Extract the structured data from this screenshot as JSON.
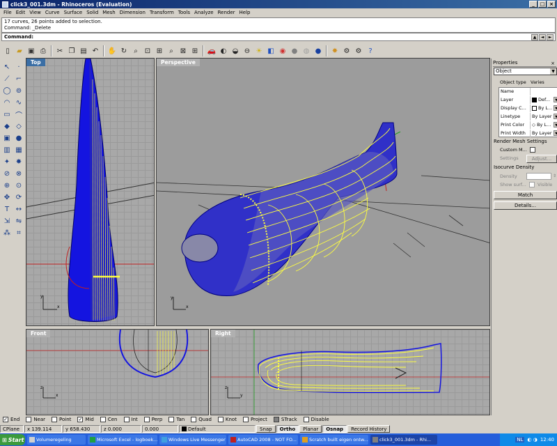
{
  "window": {
    "title": "click3_001.3dm - Rhinoceros (Evaluation)",
    "buttons": [
      "_",
      "□",
      "×"
    ]
  },
  "menu": [
    "File",
    "Edit",
    "View",
    "Curve",
    "Surface",
    "Solid",
    "Mesh",
    "Dimension",
    "Transform",
    "Tools",
    "Analyze",
    "Render",
    "Help"
  ],
  "command": {
    "history": [
      "17 curves, 26 points added to selection.",
      "Command: _Delete"
    ],
    "prompt": "Command:"
  },
  "toolbar_icons": [
    "new-file-icon",
    "open-folder-icon",
    "save-icon",
    "print-icon",
    "cut-icon",
    "copy-icon",
    "paste-icon",
    "undo-icon",
    "pan-hand-icon",
    "rotate-view-icon",
    "zoom-icon",
    "zoom-window-icon",
    "zoom-extents-icon",
    "zoom-selected-icon",
    "zoom-all-icon",
    "four-viewports-icon",
    "car-icon",
    "hide-icon",
    "show-icon",
    "lock-icon",
    "light-bulb-icon",
    "layer-icon",
    "color-wheel-icon",
    "render-sphere-icon",
    "shade-icon",
    "render-icon",
    "material-icon",
    "options-gear-icon",
    "help-icon"
  ],
  "viewports": {
    "top": "Top",
    "perspective": "Perspective",
    "front": "Front",
    "right": "Right"
  },
  "properties": {
    "title": "Properties",
    "close": "×",
    "selector": "Object",
    "object_type_label": "Object type",
    "object_type_value": "Varies",
    "rows": [
      {
        "label": "Name",
        "value": ""
      },
      {
        "label": "Layer",
        "value": "Def..."
      },
      {
        "label": "Display C...",
        "value": "By L..."
      },
      {
        "label": "Linetype",
        "value": "By Layer"
      },
      {
        "label": "Print Color",
        "value": "By L..."
      },
      {
        "label": "Print Width",
        "value": "By Layer"
      }
    ],
    "render_mesh_title": "Render Mesh Settings",
    "custom_mesh_label": "Custom M...",
    "settings_label": "Settings",
    "adjust_label": "Adjust...",
    "isocurve_title": "Isocurve Density",
    "density_label": "Density",
    "show_surface_label": "Show surf...",
    "visible_label": "Visible",
    "match_button": "Match",
    "details_button": "Details..."
  },
  "osnaps": [
    {
      "label": "End",
      "checked": true
    },
    {
      "label": "Near",
      "checked": false
    },
    {
      "label": "Point",
      "checked": false
    },
    {
      "label": "Mid",
      "checked": true
    },
    {
      "label": "Cen",
      "checked": false
    },
    {
      "label": "Int",
      "checked": false
    },
    {
      "label": "Perp",
      "checked": false
    },
    {
      "label": "Tan",
      "checked": false
    },
    {
      "label": "Quad",
      "checked": false
    },
    {
      "label": "Knot",
      "checked": false
    },
    {
      "label": "Project",
      "checked": false
    },
    {
      "label": "STrack",
      "checked": false
    },
    {
      "label": "Disable",
      "checked": false
    }
  ],
  "status": {
    "cplane": "CPlane",
    "x": "x 139.114",
    "y": "y 658.430",
    "z": "z 0.000",
    "extra": "0.000",
    "layer": "Default",
    "snap": "Snap",
    "ortho": "Ortho",
    "planar": "Planar",
    "osnap": "Osnap",
    "record": "Record History"
  },
  "taskbar": {
    "start": "Start",
    "tasks": [
      {
        "label": "Volumeregeling",
        "active": false
      },
      {
        "label": "Microsoft Excel - logboek...",
        "active": false
      },
      {
        "label": "Windows Live Messenger",
        "active": false
      },
      {
        "label": "AutoCAD 2008 - NOT FO...",
        "active": false
      },
      {
        "label": "Scratch built eigen ontw...",
        "active": false
      },
      {
        "label": "click3_001.3dm - Rhi...",
        "active": true
      }
    ],
    "lang": "NL",
    "time": "12:40"
  },
  "colors": {
    "body_blue": "#1414e0",
    "isocurve_yellow": "#ffff40",
    "active_viewport": "#3a6ea5",
    "grid": "#a8a8a8"
  }
}
